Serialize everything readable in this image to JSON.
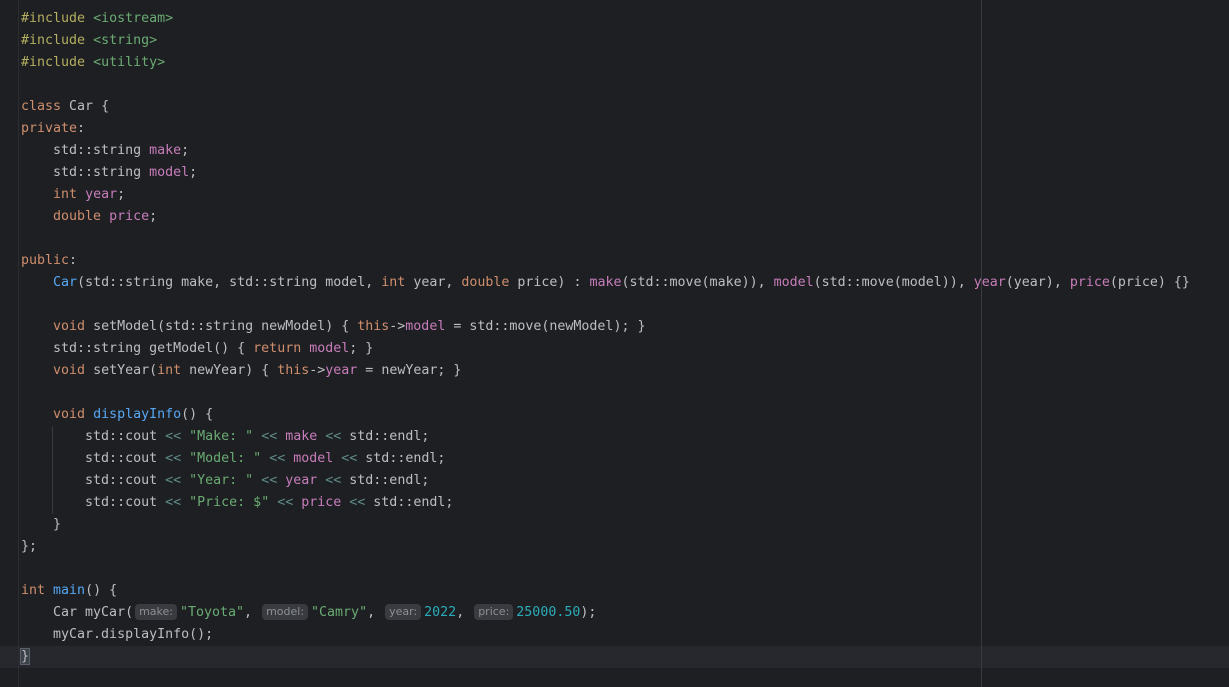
{
  "editor": {
    "language": "C++",
    "colors": {
      "background": "#1e1f22",
      "keyword": "#cf8e6d",
      "preprocessor": "#b3ae60",
      "string": "#6aab73",
      "field": "#c77dbb",
      "function": "#56a8f5",
      "number": "#2aacb8"
    },
    "lines": [
      [
        {
          "t": "pp",
          "v": "#include "
        },
        {
          "t": "inc",
          "v": "<iostream>"
        }
      ],
      [
        {
          "t": "pp",
          "v": "#include "
        },
        {
          "t": "inc",
          "v": "<string>"
        }
      ],
      [
        {
          "t": "pp",
          "v": "#include "
        },
        {
          "t": "inc",
          "v": "<utility>"
        }
      ],
      [],
      [
        {
          "t": "kw",
          "v": "class "
        },
        {
          "t": "type",
          "v": "Car "
        },
        {
          "t": "p",
          "v": "{"
        }
      ],
      [
        {
          "t": "kw",
          "v": "private"
        },
        {
          "t": "p",
          "v": ":"
        }
      ],
      [
        {
          "t": "p",
          "v": "    std::string "
        },
        {
          "t": "fld",
          "v": "make"
        },
        {
          "t": "p",
          "v": ";"
        }
      ],
      [
        {
          "t": "p",
          "v": "    std::string "
        },
        {
          "t": "fld",
          "v": "model"
        },
        {
          "t": "p",
          "v": ";"
        }
      ],
      [
        {
          "t": "p",
          "v": "    "
        },
        {
          "t": "kw",
          "v": "int "
        },
        {
          "t": "fld",
          "v": "year"
        },
        {
          "t": "p",
          "v": ";"
        }
      ],
      [
        {
          "t": "p",
          "v": "    "
        },
        {
          "t": "kw",
          "v": "double "
        },
        {
          "t": "fld",
          "v": "price"
        },
        {
          "t": "p",
          "v": ";"
        }
      ],
      [],
      [
        {
          "t": "kw",
          "v": "public"
        },
        {
          "t": "p",
          "v": ":"
        }
      ],
      [
        {
          "t": "p",
          "v": "    "
        },
        {
          "t": "ctor",
          "v": "Car"
        },
        {
          "t": "p",
          "v": "(std::string make, std::string model, "
        },
        {
          "t": "kw",
          "v": "int "
        },
        {
          "t": "p",
          "v": "year, "
        },
        {
          "t": "kw",
          "v": "double "
        },
        {
          "t": "p",
          "v": "price) : "
        },
        {
          "t": "fld",
          "v": "make"
        },
        {
          "t": "p",
          "v": "(std::move(make)), "
        },
        {
          "t": "fld",
          "v": "model"
        },
        {
          "t": "p",
          "v": "(std::move(model)), "
        },
        {
          "t": "fld",
          "v": "year"
        },
        {
          "t": "p",
          "v": "(year), "
        },
        {
          "t": "fld",
          "v": "price"
        },
        {
          "t": "p",
          "v": "(price) {}"
        }
      ],
      [],
      [
        {
          "t": "p",
          "v": "    "
        },
        {
          "t": "kw",
          "v": "void "
        },
        {
          "t": "mcall",
          "v": "setModel"
        },
        {
          "t": "p",
          "v": "(std::string newModel) { "
        },
        {
          "t": "kw",
          "v": "this"
        },
        {
          "t": "p",
          "v": "->"
        },
        {
          "t": "fld",
          "v": "model"
        },
        {
          "t": "p",
          "v": " = std::move(newModel); }"
        }
      ],
      [
        {
          "t": "p",
          "v": "    std::string "
        },
        {
          "t": "mcall",
          "v": "getModel"
        },
        {
          "t": "p",
          "v": "() { "
        },
        {
          "t": "kw",
          "v": "return "
        },
        {
          "t": "fld",
          "v": "model"
        },
        {
          "t": "p",
          "v": "; }"
        }
      ],
      [
        {
          "t": "p",
          "v": "    "
        },
        {
          "t": "kw",
          "v": "void "
        },
        {
          "t": "mcall",
          "v": "setYear"
        },
        {
          "t": "p",
          "v": "("
        },
        {
          "t": "kw",
          "v": "int "
        },
        {
          "t": "p",
          "v": "newYear) { "
        },
        {
          "t": "kw",
          "v": "this"
        },
        {
          "t": "p",
          "v": "->"
        },
        {
          "t": "fld",
          "v": "year"
        },
        {
          "t": "p",
          "v": " = newYear; }"
        }
      ],
      [],
      [
        {
          "t": "p",
          "v": "    "
        },
        {
          "t": "kw",
          "v": "void "
        },
        {
          "t": "fn",
          "v": "displayInfo"
        },
        {
          "t": "p",
          "v": "() {"
        }
      ],
      [
        {
          "t": "p",
          "v": "        std::cout "
        },
        {
          "t": "op",
          "v": "<< "
        },
        {
          "t": "str",
          "v": "\"Make: \""
        },
        {
          "t": "op",
          "v": " << "
        },
        {
          "t": "fld",
          "v": "make"
        },
        {
          "t": "op",
          "v": " << "
        },
        {
          "t": "p",
          "v": "std::endl;"
        }
      ],
      [
        {
          "t": "p",
          "v": "        std::cout "
        },
        {
          "t": "op",
          "v": "<< "
        },
        {
          "t": "str",
          "v": "\"Model: \""
        },
        {
          "t": "op",
          "v": " << "
        },
        {
          "t": "fld",
          "v": "model"
        },
        {
          "t": "op",
          "v": " << "
        },
        {
          "t": "p",
          "v": "std::endl;"
        }
      ],
      [
        {
          "t": "p",
          "v": "        std::cout "
        },
        {
          "t": "op",
          "v": "<< "
        },
        {
          "t": "str",
          "v": "\"Year: \""
        },
        {
          "t": "op",
          "v": " << "
        },
        {
          "t": "fld",
          "v": "year"
        },
        {
          "t": "op",
          "v": " << "
        },
        {
          "t": "p",
          "v": "std::endl;"
        }
      ],
      [
        {
          "t": "p",
          "v": "        std::cout "
        },
        {
          "t": "op",
          "v": "<< "
        },
        {
          "t": "str",
          "v": "\"Price: $\""
        },
        {
          "t": "op",
          "v": " << "
        },
        {
          "t": "fld",
          "v": "price"
        },
        {
          "t": "op",
          "v": " << "
        },
        {
          "t": "p",
          "v": "std::endl;"
        }
      ],
      [
        {
          "t": "p",
          "v": "    }"
        }
      ],
      [
        {
          "t": "p",
          "v": "};"
        }
      ],
      [],
      [
        {
          "t": "kw",
          "v": "int "
        },
        {
          "t": "fn",
          "v": "main"
        },
        {
          "t": "p",
          "v": "() "
        },
        {
          "t": "brace",
          "v": "{"
        }
      ],
      [
        {
          "t": "p",
          "v": "    Car myCar("
        },
        {
          "t": "hint",
          "v": "make:"
        },
        {
          "t": "str",
          "v": "\"Toyota\""
        },
        {
          "t": "p",
          "v": ", "
        },
        {
          "t": "hint",
          "v": "model:"
        },
        {
          "t": "str",
          "v": "\"Camry\""
        },
        {
          "t": "p",
          "v": ", "
        },
        {
          "t": "hint",
          "v": "year:"
        },
        {
          "t": "num",
          "v": "2022"
        },
        {
          "t": "p",
          "v": ", "
        },
        {
          "t": "hint",
          "v": "price:"
        },
        {
          "t": "num",
          "v": "25000.50"
        },
        {
          "t": "p",
          "v": ");"
        }
      ],
      [
        {
          "t": "p",
          "v": "    myCar.displayInfo();"
        }
      ],
      [
        {
          "t": "cursor",
          "v": "}"
        }
      ]
    ]
  }
}
